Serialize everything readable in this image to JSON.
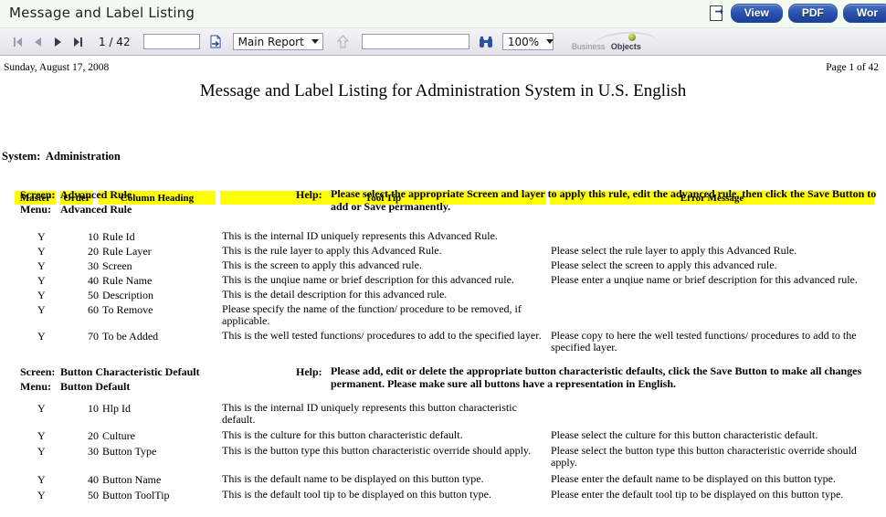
{
  "window": {
    "app_title": "Message and Label Listing",
    "export_icon": "export-page-icon",
    "buttons": [
      {
        "label": "View",
        "name": "view-button"
      },
      {
        "label": "PDF",
        "name": "pdf-button"
      },
      {
        "label": "Wor",
        "name": "word-button"
      }
    ]
  },
  "toolbar": {
    "first_page_icon": "first-page-icon",
    "prev_page_icon": "previous-page-icon",
    "next_page_icon": "next-page-icon",
    "last_page_icon": "last-page-icon",
    "page_indicator": "1 / 42",
    "page_input_value": "",
    "goto_icon": "go-to-page-icon",
    "report_select_value": "Main Report",
    "report_select_options": [
      "Main Report"
    ],
    "drill_up_icon": "drill-up-arrow-icon",
    "search_input_value": "",
    "search_icon": "binoculars-search-icon",
    "zoom_value": "100%",
    "zoom_options": [
      "100%"
    ],
    "brand_light": "Business",
    "brand_bold": "Objects"
  },
  "report": {
    "date": "Sunday, August 17, 2008",
    "page_label": "Page 1 of 42",
    "title": "Message and Label Listing for Administration System in U.S. English",
    "columns": [
      {
        "label": "Master",
        "name": "column-header-master"
      },
      {
        "label": "Order",
        "name": "column-header-order"
      },
      {
        "label": "Column Heading",
        "name": "column-header-column-heading"
      },
      {
        "label": "Tool Tip",
        "name": "column-header-tool-tip"
      },
      {
        "label": "Error Message",
        "name": "column-header-error-message"
      }
    ],
    "system_label": "System:",
    "system_value": "Administration",
    "screen_label": "Screen:",
    "menu_label": "Menu:",
    "help_label": "Help:",
    "sections": [
      {
        "screen": "Advanced Rule",
        "menu": "Advanced Rule",
        "help": "Please select the appropriate Screen and layer to apply this rule, edit the advanced rule, then click the Save Button to add or Save permanently.",
        "rows": [
          {
            "master": "Y",
            "order": "10",
            "heading": "Rule Id",
            "tooltip": "This is the internal ID uniquely represents this Advanced Rule.",
            "error": ""
          },
          {
            "master": "Y",
            "order": "20",
            "heading": "Rule Layer",
            "tooltip": "This is the rule layer to apply this Advanced Rule.",
            "error": "Please select the rule layer to apply this Advanced Rule."
          },
          {
            "master": "Y",
            "order": "30",
            "heading": "Screen",
            "tooltip": "This is the screen to apply this advanced rule.",
            "error": "Please select the screen to apply this advanced rule."
          },
          {
            "master": "Y",
            "order": "40",
            "heading": "Rule Name",
            "tooltip": "This is the unqiue name or brief description for this advanced rule.",
            "error": "Please enter a unqiue name or brief description for this advanced rule."
          },
          {
            "master": "Y",
            "order": "50",
            "heading": "Description",
            "tooltip": "This is the detail description for this advanced rule.",
            "error": ""
          },
          {
            "master": "Y",
            "order": "60",
            "heading": "To Remove",
            "tooltip": "Please specify the name of the function/ procedure to be removed, if applicable.",
            "error": ""
          },
          {
            "master": "Y",
            "order": "70",
            "heading": "To be Added",
            "tooltip": "This is the well tested functions/ procedures to add to the specified layer.",
            "error": "Please copy to here the well tested functions/ procedures to add to the specified layer."
          }
        ]
      },
      {
        "screen": "Button Characteristic Default",
        "menu": "Button Default",
        "help": "Please add, edit or delete the appropriate button characteristic defaults, click the Save Button to make all changes permanent. Please make sure all buttons have a representation in English.",
        "rows": [
          {
            "master": "Y",
            "order": "10",
            "heading": "Hlp Id",
            "tooltip": "This is the internal ID uniquely represents this button characteristic default.",
            "error": ""
          },
          {
            "master": "Y",
            "order": "20",
            "heading": "Culture",
            "tooltip": "This is the culture for this button characteristic default.",
            "error": "Please select the culture for this button characteristic default."
          },
          {
            "master": "Y",
            "order": "30",
            "heading": "Button Type",
            "tooltip": "This is the button type this button characteristic override should apply.",
            "error": "Please select the button type this button characteristic override should apply."
          },
          {
            "master": "Y",
            "order": "40",
            "heading": "Button Name",
            "tooltip": "This is the default name to be displayed on this button type.",
            "error": "Please enter the default name to be displayed on this button type."
          },
          {
            "master": "Y",
            "order": "50",
            "heading": "Button ToolTip",
            "tooltip": "This is the default tool tip to be displayed on this button type.",
            "error": "Please enter the default tool tip to be displayed on this button type."
          }
        ]
      }
    ]
  }
}
